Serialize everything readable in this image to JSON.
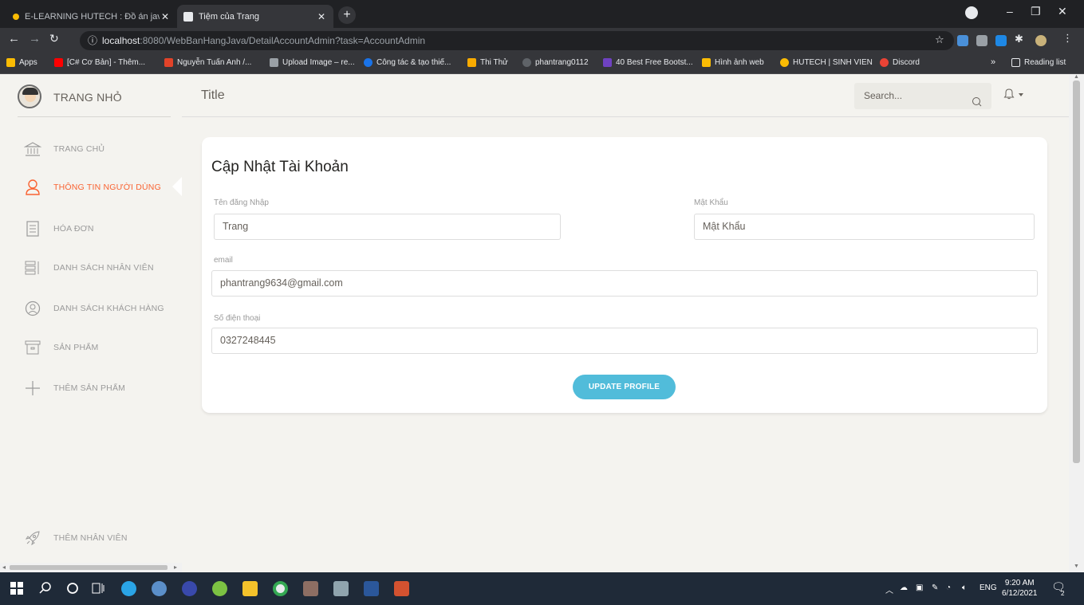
{
  "browser": {
    "tabs": [
      {
        "title": "E-LEARNING HUTECH : Đồ án jav",
        "active": false
      },
      {
        "title": "Tiệm của Trang",
        "active": true
      }
    ],
    "new_tab_label": "+",
    "address": {
      "host": "localhost",
      "rest": ":8080/WebBanHangJava/DetailAccountAdmin?task=AccountAdmin"
    },
    "window_controls": {
      "minimize": "–",
      "restore": "❐",
      "close": "✕"
    },
    "bookmarks": [
      {
        "label": "Apps",
        "color": "#fbbc04"
      },
      {
        "label": "[C# Cơ Bản] - Thêm...",
        "color": "#ff0000"
      },
      {
        "label": "Nguyễn Tuấn Anh /...",
        "color": "#e24329"
      },
      {
        "label": "Upload Image – re...",
        "color": "#9aa0a6"
      },
      {
        "label": "Công tác & tạo thiế...",
        "color": "#1a73e8"
      },
      {
        "label": "Thi Thử",
        "color": "#f9ab00"
      },
      {
        "label": "phantrang0112",
        "color": "#5f6368"
      },
      {
        "label": "40 Best Free Bootst...",
        "color": "#6f42c1"
      },
      {
        "label": "Hình ảnh web",
        "color": "#fbbc04"
      },
      {
        "label": "HUTECH | SINH VIEN",
        "color": "#fbbc04"
      },
      {
        "label": "Discord",
        "color": "#ea4335"
      }
    ],
    "more_bookmarks": "»",
    "reading_list": "Reading list"
  },
  "sidebar": {
    "brand": "TRANG NHỎ",
    "items": [
      {
        "label": "TRANG CHỦ",
        "icon": "bank-icon",
        "active": false
      },
      {
        "label": "THÔNG TIN NGƯỜI DÙNG",
        "icon": "user-icon",
        "active": true
      },
      {
        "label": "HÓA ĐƠN",
        "icon": "paper-icon",
        "active": false
      },
      {
        "label": "DANH SÁCH NHÂN VIÊN",
        "icon": "list-icon",
        "active": false
      },
      {
        "label": "DANH SÁCH KHÁCH HÀNG",
        "icon": "user-circle-icon",
        "active": false
      },
      {
        "label": "SẢN PHẨM",
        "icon": "box-icon",
        "active": false
      },
      {
        "label": "THÊM SẢN PHẨM",
        "icon": "plus-icon",
        "active": false
      }
    ],
    "bottom_item": {
      "label": "THÊM NHÂN VIÊN",
      "icon": "spaceship-icon"
    }
  },
  "topbar": {
    "title": "Title",
    "search_placeholder": "Search..."
  },
  "form": {
    "heading": "Cập Nhật Tài Khoản",
    "username": {
      "label": "Tên đăng Nhập",
      "value": "Trang"
    },
    "password": {
      "label": "Mật Khẩu",
      "value": "Mật Khẩu"
    },
    "email": {
      "label": "email",
      "value": "phantrang9634@gmail.com"
    },
    "phone": {
      "label": "Số điện thoại",
      "value": "0327248445"
    },
    "submit": "UPDATE PROFILE"
  },
  "taskbar": {
    "language": "ENG",
    "time": "9:20 AM",
    "date": "6/12/2021",
    "notification_count": "2"
  },
  "colors": {
    "accent_active": "#f96332",
    "button": "#51bcda",
    "page_bg": "#f4f3ef"
  }
}
